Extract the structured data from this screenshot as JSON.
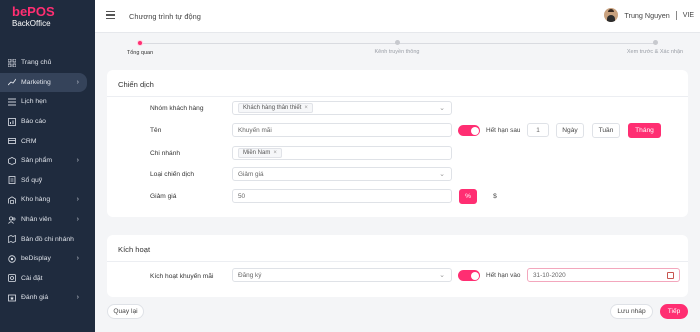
{
  "logo": {
    "be": "be",
    "pos": "POS",
    "sub": "BackOffice"
  },
  "sidebar": {
    "items": [
      {
        "label": "Trang chủ",
        "icon": "grid-icon",
        "chevron": ""
      },
      {
        "label": "Marketing",
        "icon": "chart-line-icon",
        "chevron": "›",
        "active": true
      },
      {
        "label": "Lịch hẹn",
        "icon": "list-icon",
        "chevron": ""
      },
      {
        "label": "Báo cáo",
        "icon": "chart-bar-icon",
        "chevron": ""
      },
      {
        "label": "CRM",
        "icon": "card-icon",
        "chevron": ""
      },
      {
        "label": "Sản phẩm",
        "icon": "box-icon",
        "chevron": "›"
      },
      {
        "label": "Sổ quỹ",
        "icon": "ledger-icon",
        "chevron": ""
      },
      {
        "label": "Kho hàng",
        "icon": "warehouse-icon",
        "chevron": "›"
      },
      {
        "label": "Nhân viên",
        "icon": "users-icon",
        "chevron": "›"
      },
      {
        "label": "Bản đồ chi nhánh",
        "icon": "map-icon",
        "chevron": ""
      },
      {
        "label": "beDisplay",
        "icon": "display-icon",
        "chevron": "›"
      },
      {
        "label": "Cài đặt",
        "icon": "gear-icon",
        "chevron": ""
      },
      {
        "label": "Đánh giá",
        "icon": "star-icon",
        "chevron": "›"
      }
    ]
  },
  "header": {
    "title": "Chương trình tự động",
    "user_name": "Trung Nguyen",
    "language": "VIE"
  },
  "stepper": {
    "steps": [
      {
        "label": "Tổng quan",
        "active": true
      },
      {
        "label": "Kênh truyền thông",
        "active": false
      },
      {
        "label": "Xem trước & Xác nhận",
        "active": false
      }
    ]
  },
  "campaign": {
    "title": "Chiến dịch",
    "customer_group": {
      "label": "Nhóm khách hàng",
      "tag": "Khách hàng thân thiết"
    },
    "name": {
      "label": "Tên",
      "value": "Khuyến mãi"
    },
    "expiry": {
      "label": "Hết hạn sau",
      "value": "1",
      "units": [
        "Ngày",
        "Tuần",
        "Tháng"
      ],
      "selected": "Tháng"
    },
    "branch": {
      "label": "Chi nhánh",
      "tag": "Miền Nam"
    },
    "campaign_type": {
      "label": "Loại chiến dịch",
      "value": "Giảm giá"
    },
    "discount": {
      "label": "Giảm giá",
      "value": "50",
      "percent": "%",
      "currency": "$"
    }
  },
  "activation": {
    "title": "Kích hoạt",
    "trigger": {
      "label": "Kích hoạt khuyến mãi",
      "value": "Đăng ký"
    },
    "expire": {
      "label": "Hết hạn vào",
      "date": "31-10-2020"
    }
  },
  "footer": {
    "back": "Quay lại",
    "draft": "Lưu nháp",
    "next": "Tiếp"
  },
  "colors": {
    "accent": "#ff2e72",
    "sidebar": "#1f2b3e"
  }
}
